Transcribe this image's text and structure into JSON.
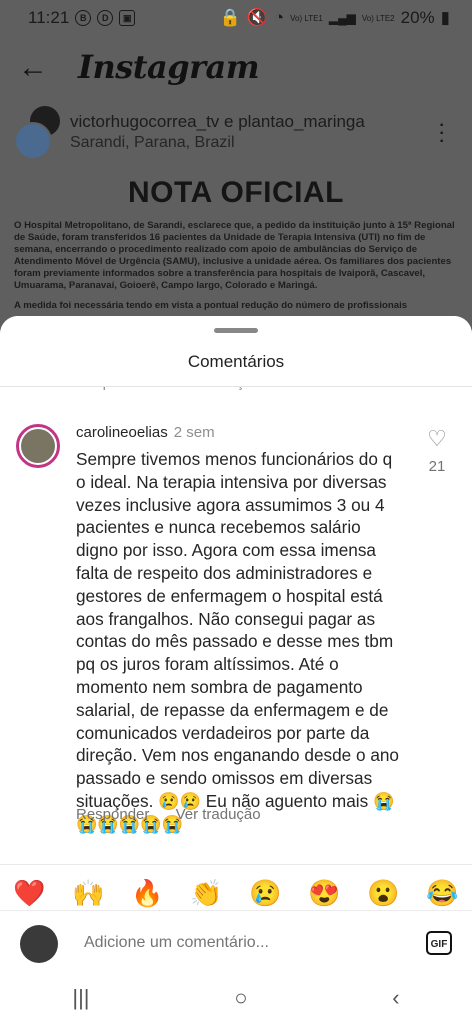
{
  "status": {
    "time": "11:21",
    "battery": "20%",
    "net1": "Vo) LTE1",
    "net2": "Vo) LTE2"
  },
  "app": {
    "brand": "Instagram"
  },
  "post": {
    "authors": "victorhugocorrea_tv e plantao_maringa",
    "location": "Sarandi, Parana, Brazil",
    "title": "NOTA OFICIAL",
    "para1": "O Hospital Metropolitano, de Sarandi, esclarece que, a pedido da instituição junto à 15ª Regional de Saúde, foram transferidos 16 pacientes da Unidade de Terapia Intensiva (UTI) no fim de semana, encerrando o procedimento realizado com apoio de ambulâncias do Serviço de Atendimento Móvel de Urgência (SAMU), inclusive a unidade aérea. Os familiares dos pacientes foram previamente informados sobre a transferência para hospitais de Ivaiporã, Cascavel, Umuarama, Paranavaí, Goioerê, Campo largo, Colorado e Maringá.",
    "para2": "A medida foi necessária tendo em vista a pontual redução do número de profissionais"
  },
  "sheet": {
    "title": "Comentários",
    "prev_reply": "Responder",
    "prev_translate": "Ver tradução"
  },
  "comment": {
    "user": "carolineoelias",
    "time": "2 sem",
    "text": "Sempre tivemos menos funcionários do q o ideal. Na terapia intensiva por diversas vezes inclusive agora assumimos 3 ou 4 pacientes e nunca recebemos salário digno por isso. Agora com essa imensa falta de respeito dos administradores e gestores de enfermagem o hospital está aos frangalhos. Não consegui pagar as contas do mês passado e desse mes tbm pq os juros foram altíssimos. Até o momento nem sombra de pagamento salarial, de repasse da enfermagem e de comunicados verdadeiros por parte da direção. Vem nos enganando desde o ano passado e sendo omissos em diversas situações. 😢😢 Eu não aguento mais 😭😭😭😭😭😭",
    "likes": "21",
    "reply": "Responder",
    "translate": "Ver tradução"
  },
  "reactions": [
    "❤️",
    "🙌",
    "🔥",
    "👏",
    "😢",
    "😍",
    "😮",
    "😂"
  ],
  "input": {
    "placeholder": "Adicione um comentário...",
    "gif": "GIF"
  },
  "nav": {
    "recents": "|||",
    "home": "○",
    "back": "‹"
  }
}
